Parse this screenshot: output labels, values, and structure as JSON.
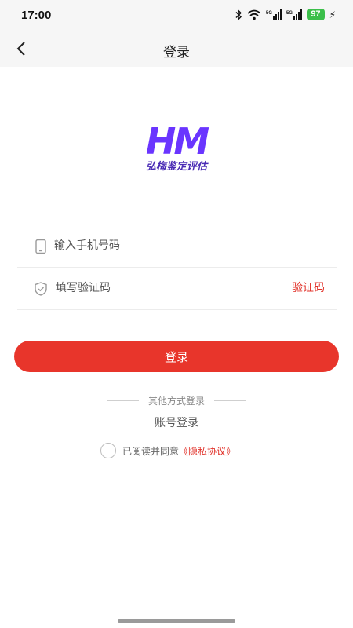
{
  "status_bar": {
    "time": "17:00",
    "battery": "97",
    "icons": [
      "bluetooth-icon",
      "wifi-icon",
      "signal-5g-icon",
      "signal-5g-icon",
      "charging-icon"
    ]
  },
  "header": {
    "title": "登录",
    "back_icon": "chevron-left-icon"
  },
  "logo": {
    "letters": "HM",
    "caption": "弘梅鉴定评估",
    "color": "#6a35ff"
  },
  "form": {
    "phone_placeholder": "输入手机号码",
    "code_placeholder": "填写验证码",
    "code_button": "验证码"
  },
  "login_button": "登录",
  "other_methods": {
    "divider_text": "其他方式登录",
    "account_login": "账号登录"
  },
  "agreement": {
    "text": "已阅读并同意",
    "link": "《隐私协议》"
  },
  "colors": {
    "accent": "#e8352b",
    "brand": "#6a35ff"
  }
}
